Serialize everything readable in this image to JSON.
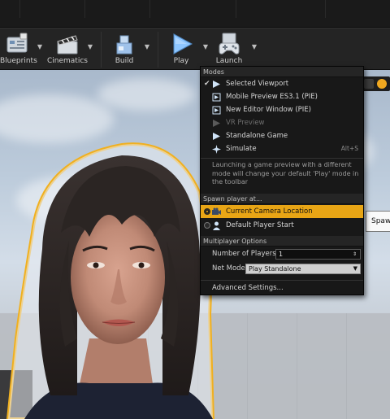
{
  "toolbar": {
    "buttons": [
      {
        "label": "Blueprints"
      },
      {
        "label": "Cinematics"
      },
      {
        "label": "Build"
      },
      {
        "label": "Play"
      },
      {
        "label": "Launch"
      }
    ]
  },
  "viewport": {
    "tooltip_fragment": "Spaw"
  },
  "menu": {
    "modes_header": "Modes",
    "modes": [
      {
        "label": "Selected Viewport",
        "checked": true,
        "disabled": false,
        "shortcut": ""
      },
      {
        "label": "Mobile Preview ES3.1 (PIE)",
        "checked": false,
        "disabled": false,
        "shortcut": ""
      },
      {
        "label": "New Editor Window (PIE)",
        "checked": false,
        "disabled": false,
        "shortcut": ""
      },
      {
        "label": "VR Preview",
        "checked": false,
        "disabled": true,
        "shortcut": ""
      },
      {
        "label": "Standalone Game",
        "checked": false,
        "disabled": false,
        "shortcut": ""
      },
      {
        "label": "Simulate",
        "checked": false,
        "disabled": false,
        "shortcut": "Alt+S"
      }
    ],
    "modes_note": "Launching a game preview with a different mode will change your default 'Play' mode in the toolbar",
    "spawn_header": "Spawn player at...",
    "spawn_options": [
      {
        "label": "Current Camera Location",
        "selected": true
      },
      {
        "label": "Default Player Start",
        "selected": false
      }
    ],
    "multiplayer_header": "Multiplayer Options",
    "num_players_label": "Number of Players",
    "num_players_value": "1",
    "net_mode_label": "Net Mode",
    "net_mode_value": "Play Standalone",
    "advanced_label": "Advanced Settings..."
  },
  "colors": {
    "highlight": "#e8a515",
    "outline": "#f0b020"
  }
}
